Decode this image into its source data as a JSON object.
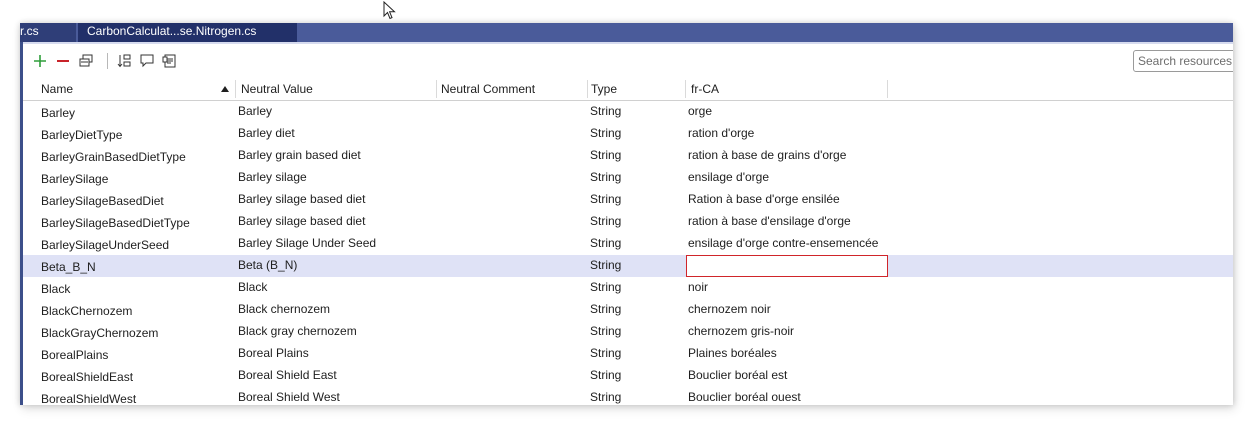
{
  "tabs": {
    "previous": "r.cs",
    "active": "CarbonCalculat...se.Nitrogen.cs"
  },
  "search": {
    "placeholder": "Search resources ("
  },
  "toolbar": {
    "icons": [
      "add-icon",
      "remove-icon",
      "copy-icon",
      "sort-icon",
      "comment-icon",
      "document-icon"
    ]
  },
  "columns": {
    "name": "Name",
    "neutral_value": "Neutral Value",
    "neutral_comment": "Neutral Comment",
    "type": "Type",
    "fr_ca": "fr-CA"
  },
  "rows": [
    {
      "name": "Barley",
      "value": "Barley",
      "type": "String",
      "fr": "orge"
    },
    {
      "name": "BarleyDietType",
      "value": "Barley diet",
      "type": "String",
      "fr": "ration d'orge"
    },
    {
      "name": "BarleyGrainBasedDietType",
      "value": "Barley grain based diet",
      "type": "String",
      "fr": "ration à base de grains d'orge"
    },
    {
      "name": "BarleySilage",
      "value": "Barley silage",
      "type": "String",
      "fr": "ensilage d'orge"
    },
    {
      "name": "BarleySilageBasedDiet",
      "value": "Barley silage based diet",
      "type": "String",
      "fr": "Ration à base d'orge ensilée"
    },
    {
      "name": "BarleySilageBasedDietType",
      "value": "Barley silage based diet",
      "type": "String",
      "fr": "ration à base d'ensilage d'orge"
    },
    {
      "name": "BarleySilageUnderSeed",
      "value": "Barley Silage Under Seed",
      "type": "String",
      "fr": "ensilage d'orge contre-ensemencée"
    },
    {
      "name": "Beta_B_N",
      "value": "Beta (B_N)",
      "type": "String",
      "fr": ""
    },
    {
      "name": "Black",
      "value": "Black",
      "type": "String",
      "fr": "noir"
    },
    {
      "name": "BlackChernozem",
      "value": "Black chernozem",
      "type": "String",
      "fr": "chernozem noir"
    },
    {
      "name": "BlackGrayChernozem",
      "value": "Black gray chernozem",
      "type": "String",
      "fr": "chernozem gris-noir"
    },
    {
      "name": "BorealPlains",
      "value": "Boreal Plains",
      "type": "String",
      "fr": "Plaines boréales"
    },
    {
      "name": "BorealShieldEast",
      "value": "Boreal Shield East",
      "type": "String",
      "fr": "Bouclier boréal est"
    },
    {
      "name": "BorealShieldWest",
      "value": "Boreal Shield West",
      "type": "String",
      "fr": "Bouclier boréal ouest"
    }
  ],
  "selected_row": "Beta_B_N",
  "colors": {
    "tab_strip": "#4a5b9a",
    "active_tab": "#223069",
    "selected_row": "#dfe2f6",
    "edit_border": "#d0252a"
  }
}
